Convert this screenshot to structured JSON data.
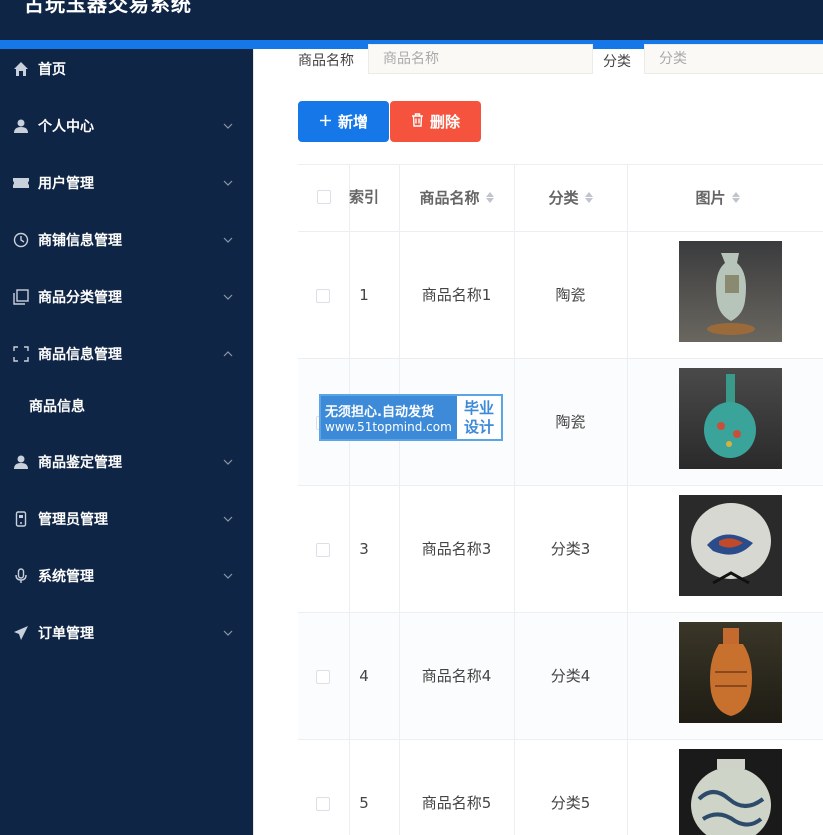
{
  "app": {
    "title": "古玩玉器交易系统"
  },
  "sidebar": {
    "items": [
      {
        "label": "首页",
        "icon": "home-icon"
      },
      {
        "label": "个人中心",
        "icon": "user-icon"
      },
      {
        "label": "用户管理",
        "icon": "ticket-icon"
      },
      {
        "label": "商铺信息管理",
        "icon": "clock-icon"
      },
      {
        "label": "商品分类管理",
        "icon": "copy-icon"
      },
      {
        "label": "商品信息管理",
        "icon": "fullscreen-icon"
      },
      {
        "label": "商品信息",
        "icon": ""
      },
      {
        "label": "商品鉴定管理",
        "icon": "user-icon"
      },
      {
        "label": "管理员管理",
        "icon": "phone-icon"
      },
      {
        "label": "系统管理",
        "icon": "microphone-icon"
      },
      {
        "label": "订单管理",
        "icon": "send-icon"
      }
    ]
  },
  "search": {
    "name_label": "商品名称",
    "name_placeholder": "商品名称",
    "category_label": "分类",
    "category_placeholder": "分类"
  },
  "toolbar": {
    "add_label": "新增",
    "delete_label": "删除"
  },
  "table": {
    "headers": {
      "index": "索引",
      "name": "商品名称",
      "category": "分类",
      "image": "图片"
    },
    "rows": [
      {
        "index": "1",
        "name": "商品名称1",
        "category": "陶瓷"
      },
      {
        "index": "",
        "name": "",
        "category": "陶瓷"
      },
      {
        "index": "3",
        "name": "商品名称3",
        "category": "分类3"
      },
      {
        "index": "4",
        "name": "商品名称4",
        "category": "分类4"
      },
      {
        "index": "5",
        "name": "商品名称5",
        "category": "分类5"
      }
    ]
  },
  "watermark": {
    "line1": "无须担心.自动发货",
    "line2": "www.51topmind.com",
    "tag_top": "毕业",
    "tag_bottom": "设计"
  },
  "colors": {
    "sidebar_bg": "#0f2545",
    "accent": "#1677e8",
    "danger": "#f5533d"
  }
}
